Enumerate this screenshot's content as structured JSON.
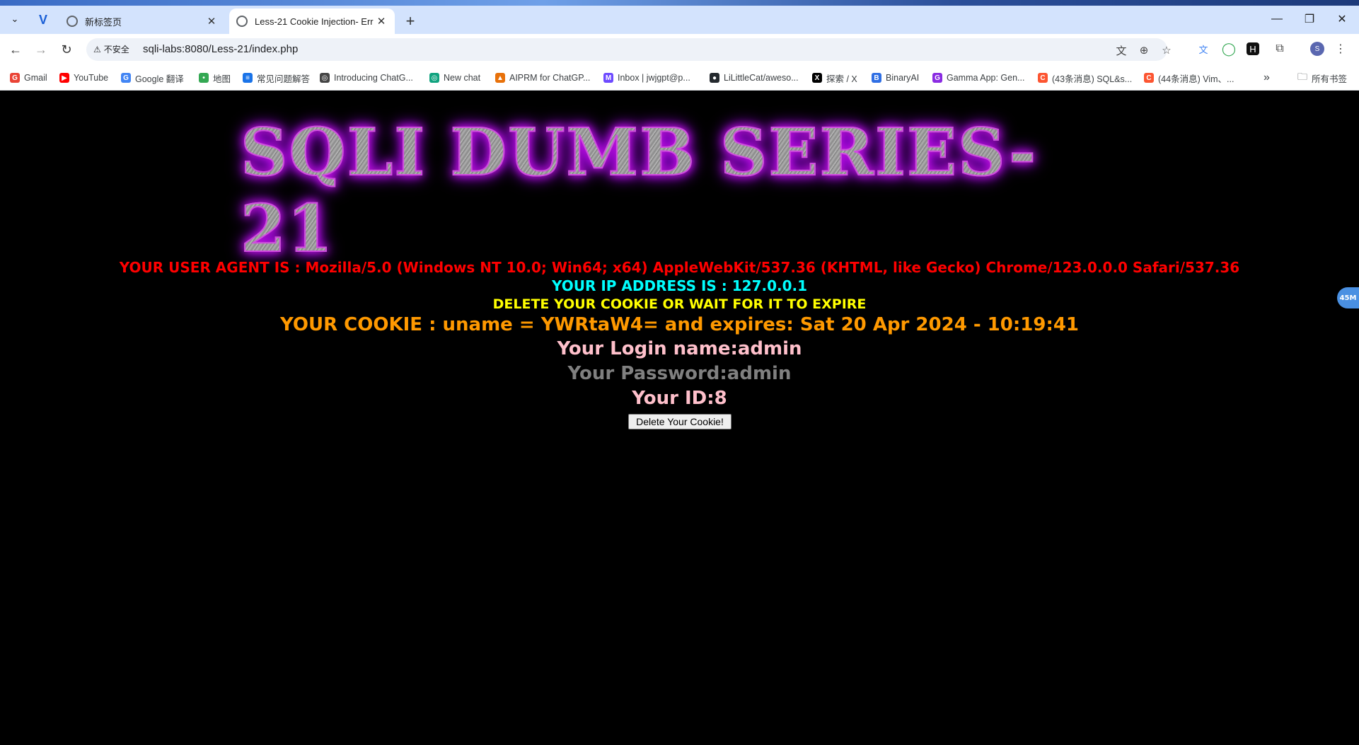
{
  "browser": {
    "tabs": [
      {
        "title": "新标签页",
        "active": false
      },
      {
        "title": "Less-21 Cookie Injection- Err",
        "active": true
      }
    ],
    "address": {
      "security_label": "不安全",
      "url": "sqli-labs:8080/Less-21/index.php"
    },
    "bookmarks": [
      {
        "label": "Gmail",
        "icon": "gmail-icon",
        "color": "#ea4335"
      },
      {
        "label": "YouTube",
        "icon": "youtube-icon",
        "color": "#ff0000"
      },
      {
        "label": "Google 翻译",
        "icon": "translate-icon",
        "color": "#4285f4"
      },
      {
        "label": "地图",
        "icon": "maps-icon",
        "color": "#34a853"
      },
      {
        "label": "常见问题解答",
        "icon": "doc-icon",
        "color": "#1a73e8"
      },
      {
        "label": "Introducing ChatG...",
        "icon": "openai-icon",
        "color": "#444444"
      },
      {
        "label": "New chat",
        "icon": "chatgpt-icon",
        "color": "#10a37f"
      },
      {
        "label": "AIPRM for ChatGP...",
        "icon": "aiprm-icon",
        "color": "#e8710a"
      },
      {
        "label": "Inbox | jwjgpt@p...",
        "icon": "proton-icon",
        "color": "#6d4aff"
      },
      {
        "label": "LiLittleCat/aweso...",
        "icon": "github-icon",
        "color": "#24292e"
      },
      {
        "label": "探索 / X",
        "icon": "x-icon",
        "color": "#000000"
      },
      {
        "label": "BinaryAI",
        "icon": "binaryai-icon",
        "color": "#2f6fe4"
      },
      {
        "label": "Gamma App: Gen...",
        "icon": "gamma-icon",
        "color": "#8a2be2"
      },
      {
        "label": "(43条消息) SQL&s...",
        "icon": "csdn-icon",
        "color": "#fc5531"
      },
      {
        "label": "(44条消息) Vim、...",
        "icon": "csdn-icon",
        "color": "#fc5531"
      }
    ],
    "all_bookmarks_label": "所有书签"
  },
  "page": {
    "banner": "SQLI DUMB SERIES-21",
    "user_agent_line": "YOUR USER AGENT IS : Mozilla/5.0 (Windows NT 10.0; Win64; x64) AppleWebKit/537.36 (KHTML, like Gecko) Chrome/123.0.0.0 Safari/537.36",
    "ip_line": "YOUR IP ADDRESS IS : 127.0.0.1",
    "delete_notice": "DELETE YOUR COOKIE OR WAIT FOR IT TO EXPIRE",
    "cookie_line": "YOUR COOKIE : uname = YWRtaW4= and expires: Sat 20 Apr 2024 - 10:19:41",
    "login_line": "Your Login name:admin",
    "password_line": "Your Password:admin",
    "id_line": "Your ID:8",
    "delete_button": "Delete Your Cookie!",
    "float_badge": "45M"
  },
  "colors": {
    "user_agent": "#ff0000",
    "ip": "#00ffff",
    "notice": "#ffff00",
    "cookie": "#ff9900",
    "login": "#ffc0cb",
    "password": "#808080",
    "banner_glow": "#c013d8"
  }
}
